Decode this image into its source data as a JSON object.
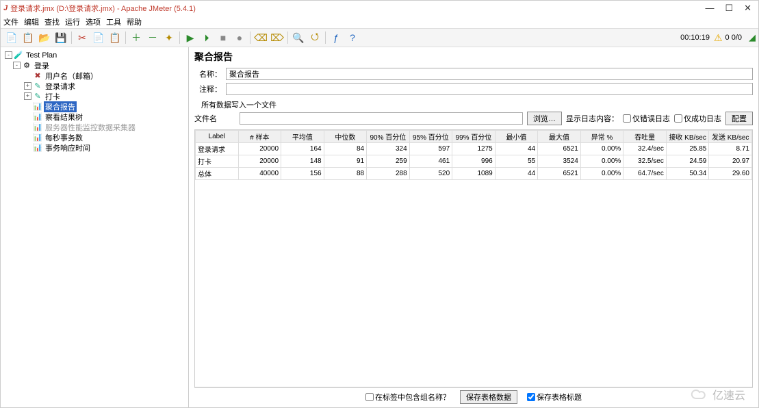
{
  "window": {
    "title": "登录请求.jmx (D:\\登录请求.jmx) - Apache JMeter (5.4.1)",
    "controls": {
      "min": "—",
      "max": "☐",
      "close": "✕"
    }
  },
  "menubar": [
    "文件",
    "编辑",
    "查找",
    "运行",
    "选项",
    "工具",
    "帮助"
  ],
  "toolbar_status": {
    "timer": "00:10:19",
    "counts": "0  0/0"
  },
  "tree": {
    "root": "Test Plan",
    "login_group": "登录",
    "username": "用户名（邮箱）",
    "login_request": "登录请求",
    "daka": "打卡",
    "aggregate": "聚合报告",
    "view_tree": "察看结果树",
    "server_collector": "服务器性能监控数据采集器",
    "tps": "每秒事务数",
    "resp_time": "事务响应时间"
  },
  "panel": {
    "title": "聚合报告",
    "name_label": "名称：",
    "name_value": "聚合报告",
    "comment_label": "注释：",
    "comment_value": "",
    "write_label": "所有数据写入一个文件",
    "file_label": "文件名",
    "browse": "浏览…",
    "show_log_label": "显示日志内容：",
    "only_error": "仅错误日志",
    "only_success": "仅成功日志",
    "config": "配置"
  },
  "table": {
    "headers": [
      "Label",
      "# 样本",
      "平均值",
      "中位数",
      "90% 百分位",
      "95% 百分位",
      "99% 百分位",
      "最小值",
      "最大值",
      "异常 %",
      "吞吐量",
      "接收 KB/sec",
      "发送 KB/sec"
    ],
    "rows": [
      {
        "label": "登录请求",
        "v": [
          "20000",
          "164",
          "84",
          "324",
          "597",
          "1275",
          "44",
          "6521",
          "0.00%",
          "32.4/sec",
          "25.85",
          "8.71"
        ]
      },
      {
        "label": "打卡",
        "v": [
          "20000",
          "148",
          "91",
          "259",
          "461",
          "996",
          "55",
          "3524",
          "0.00%",
          "32.5/sec",
          "24.59",
          "20.97"
        ]
      },
      {
        "label": "总体",
        "v": [
          "40000",
          "156",
          "88",
          "288",
          "520",
          "1089",
          "44",
          "6521",
          "0.00%",
          "64.7/sec",
          "50.34",
          "29.60"
        ]
      }
    ]
  },
  "footer": {
    "include_group": "在标签中包含组名称？",
    "save_data": "保存表格数据",
    "save_header": "保存表格标题"
  },
  "watermark": "亿速云"
}
